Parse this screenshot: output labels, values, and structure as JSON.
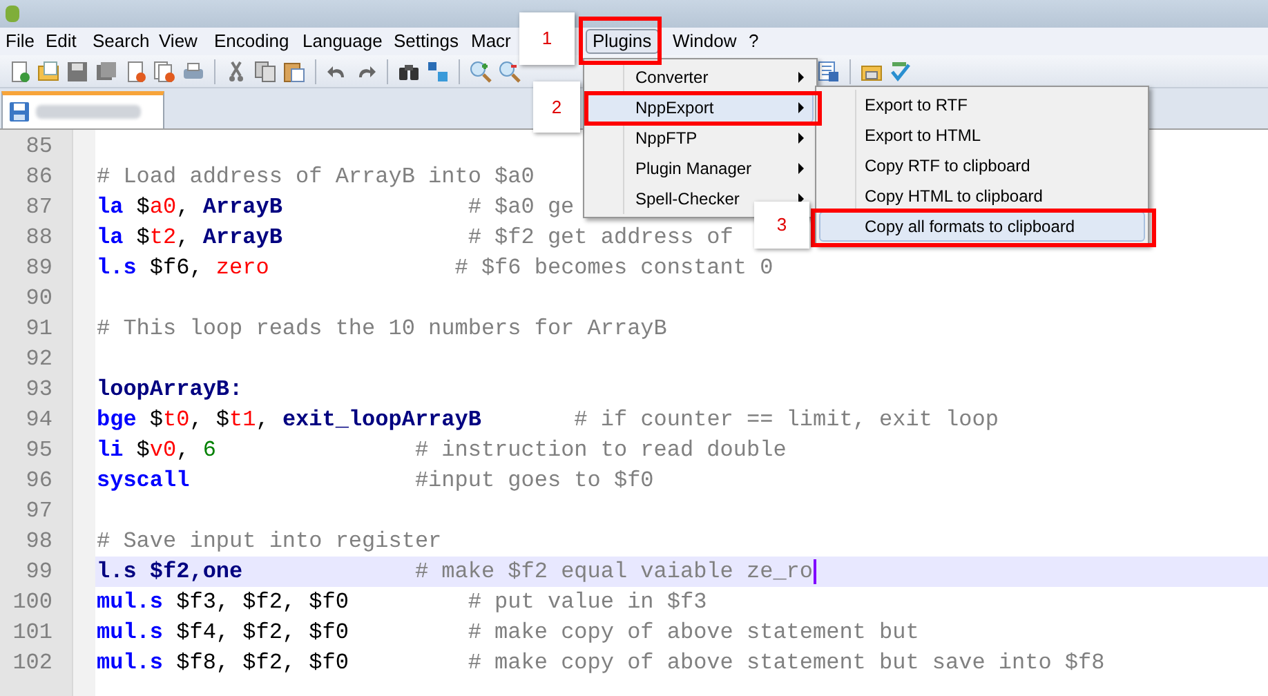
{
  "menu_bar": [
    {
      "label": "File",
      "selected": false
    },
    {
      "label": "Edit",
      "selected": false
    },
    {
      "label": "Search",
      "selected": false
    },
    {
      "label": "View",
      "selected": false
    },
    {
      "label": "Encoding",
      "selected": false
    },
    {
      "label": "Language",
      "selected": false
    },
    {
      "label": "Settings",
      "selected": false
    },
    {
      "label": "Macr",
      "selected": false
    },
    {
      "label": "Plugins",
      "selected": true
    },
    {
      "label": "Window",
      "selected": false
    },
    {
      "label": "?",
      "selected": false
    }
  ],
  "plugins_menu": [
    {
      "label": "Converter",
      "selected": false
    },
    {
      "label": "NppExport",
      "selected": true
    },
    {
      "label": "NppFTP",
      "selected": false
    },
    {
      "label": "Plugin Manager",
      "selected": false
    },
    {
      "label": "Spell-Checker",
      "selected": false
    }
  ],
  "nppexport_submenu": [
    {
      "label": "Export to RTF",
      "selected": false
    },
    {
      "label": "Export to HTML",
      "selected": false
    },
    {
      "label": "Copy RTF to clipboard",
      "selected": false
    },
    {
      "label": "Copy HTML to clipboard",
      "selected": false
    },
    {
      "label": "Copy all formats to clipboard",
      "selected": true
    }
  ],
  "callouts": [
    "1",
    "2",
    "3"
  ],
  "editor": {
    "lines": [
      {
        "number": "85",
        "current": false
      },
      {
        "number": "86",
        "current": false,
        "tokens": [
          {
            "kind": "comment",
            "text": "# Load address of ArrayB into $a0"
          }
        ]
      },
      {
        "number": "87",
        "current": false,
        "tokens": [
          {
            "kind": "instruction",
            "text": "la"
          },
          {
            "kind": "plain",
            "text": " $"
          },
          {
            "kind": "register",
            "text": "a0"
          },
          {
            "kind": "plain",
            "text": ", "
          },
          {
            "kind": "label",
            "text": "ArrayB"
          },
          {
            "kind": "comment",
            "text": "              # $a0 ge"
          }
        ]
      },
      {
        "number": "88",
        "current": false,
        "tokens": [
          {
            "kind": "instruction",
            "text": "la"
          },
          {
            "kind": "plain",
            "text": " $"
          },
          {
            "kind": "register",
            "text": "t2"
          },
          {
            "kind": "plain",
            "text": ", "
          },
          {
            "kind": "label",
            "text": "ArrayB"
          },
          {
            "kind": "comment",
            "text": "              # $f2 get address of"
          }
        ]
      },
      {
        "number": "89",
        "current": false,
        "tokens": [
          {
            "kind": "instruction",
            "text": "l.s"
          },
          {
            "kind": "plain",
            "text": " $f6, "
          },
          {
            "kind": "register",
            "text": "zero"
          },
          {
            "kind": "comment",
            "text": "              # $f6 becomes constant 0"
          }
        ]
      },
      {
        "number": "90",
        "current": false
      },
      {
        "number": "91",
        "current": false,
        "tokens": [
          {
            "kind": "comment",
            "text": "# This loop reads the 10 numbers for ArrayB"
          }
        ]
      },
      {
        "number": "92",
        "current": false
      },
      {
        "number": "93",
        "current": false,
        "tokens": [
          {
            "kind": "label",
            "text": "loopArrayB:"
          }
        ]
      },
      {
        "number": "94",
        "current": false,
        "tokens": [
          {
            "kind": "instruction",
            "text": "bge"
          },
          {
            "kind": "plain",
            "text": " $"
          },
          {
            "kind": "register",
            "text": "t0"
          },
          {
            "kind": "plain",
            "text": ", $"
          },
          {
            "kind": "register",
            "text": "t1"
          },
          {
            "kind": "plain",
            "text": ", "
          },
          {
            "kind": "label",
            "text": "exit_loopArrayB"
          },
          {
            "kind": "comment",
            "text": "       # if counter == limit, exit loop"
          }
        ]
      },
      {
        "number": "95",
        "current": false,
        "tokens": [
          {
            "kind": "instruction",
            "text": "li"
          },
          {
            "kind": "plain",
            "text": " $"
          },
          {
            "kind": "register",
            "text": "v0"
          },
          {
            "kind": "plain",
            "text": ", "
          },
          {
            "kind": "number",
            "text": "6"
          },
          {
            "kind": "comment",
            "text": "               # instruction to read double"
          }
        ]
      },
      {
        "number": "96",
        "current": false,
        "tokens": [
          {
            "kind": "instruction",
            "text": "syscall"
          },
          {
            "kind": "comment",
            "text": "                 #input goes to $f0"
          }
        ]
      },
      {
        "number": "97",
        "current": false
      },
      {
        "number": "98",
        "current": false,
        "tokens": [
          {
            "kind": "comment",
            "text": "# Save input into register"
          }
        ]
      },
      {
        "number": "99",
        "current": true,
        "tokens": [
          {
            "kind": "label",
            "text": "l.s $f2,one"
          },
          {
            "kind": "comment",
            "text": "             # make $f2 equal vaiable ze_ro"
          }
        ]
      },
      {
        "number": "100",
        "current": false,
        "tokens": [
          {
            "kind": "instruction",
            "text": "mul.s"
          },
          {
            "kind": "plain",
            "text": " $f3, $f2, $f0"
          },
          {
            "kind": "comment",
            "text": "         # put value in $f3"
          }
        ]
      },
      {
        "number": "101",
        "current": false,
        "tokens": [
          {
            "kind": "instruction",
            "text": "mul.s"
          },
          {
            "kind": "plain",
            "text": " $f4, $f2, $f0"
          },
          {
            "kind": "comment",
            "text": "         # make copy of above statement but"
          }
        ]
      },
      {
        "number": "102",
        "current": false,
        "tokens": [
          {
            "kind": "instruction",
            "text": "mul.s"
          },
          {
            "kind": "plain",
            "text": " $f8, $f2, $f0"
          },
          {
            "kind": "comment",
            "text": "         # make copy of above statement but save into $f8"
          }
        ]
      }
    ]
  }
}
